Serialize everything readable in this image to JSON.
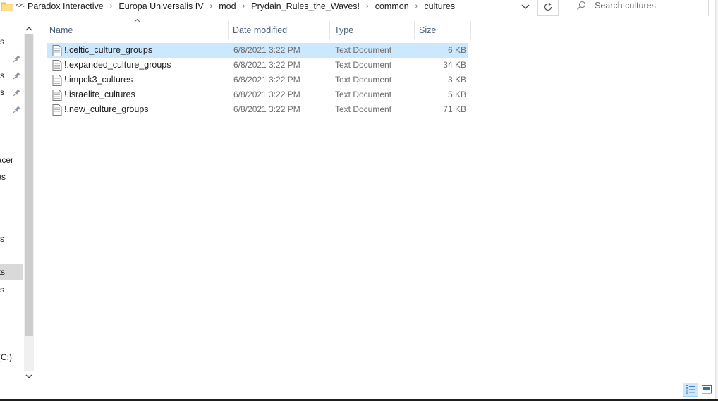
{
  "address_bar": {
    "overflow": "<<",
    "crumbs": [
      "Paradox Interactive",
      "Europa Universalis IV",
      "mod",
      "Prydain_Rules_the_Waves!",
      "common",
      "cultures"
    ]
  },
  "search": {
    "placeholder": "Search cultures",
    "value": ""
  },
  "nav_pane": {
    "items": [
      {
        "label": "s",
        "pinned": false
      },
      {
        "label": "s",
        "pinned": true
      },
      {
        "label": "ts",
        "pinned": true
      },
      {
        "label": "",
        "pinned": true
      },
      {
        "label": "acer",
        "pinned": false
      },
      {
        "label": "es",
        "pinned": false
      },
      {
        "label": "s",
        "pinned": false
      },
      {
        "label": "ts",
        "pinned": false,
        "selected": true
      },
      {
        "label": "s",
        "pinned": false
      },
      {
        "label": "(C:)",
        "pinned": false
      }
    ]
  },
  "file_list": {
    "columns": {
      "name": "Name",
      "date": "Date modified",
      "type": "Type",
      "size": "Size"
    },
    "rows": [
      {
        "name": "!.celtic_culture_groups",
        "date": "6/8/2021 3:22 PM",
        "type": "Text Document",
        "size": "6 KB",
        "selected": true
      },
      {
        "name": "!.expanded_culture_groups",
        "date": "6/8/2021 3:22 PM",
        "type": "Text Document",
        "size": "34 KB"
      },
      {
        "name": "!.impck3_cultures",
        "date": "6/8/2021 3:22 PM",
        "type": "Text Document",
        "size": "3 KB"
      },
      {
        "name": "!.israelite_cultures",
        "date": "6/8/2021 3:22 PM",
        "type": "Text Document",
        "size": "5 KB"
      },
      {
        "name": "!.new_culture_groups",
        "date": "6/8/2021 3:22 PM",
        "type": "Text Document",
        "size": "71 KB"
      }
    ]
  },
  "colors": {
    "accent_selected": "#cce8ff",
    "header_text": "#4c607a",
    "muted_text": "#6d6d6d"
  },
  "icons": [
    "folder-icon",
    "chevron-right-icon",
    "chevron-down-icon",
    "refresh-icon",
    "search-icon",
    "pin-icon",
    "text-file-icon",
    "details-view-icon",
    "large-icons-view-icon"
  ]
}
